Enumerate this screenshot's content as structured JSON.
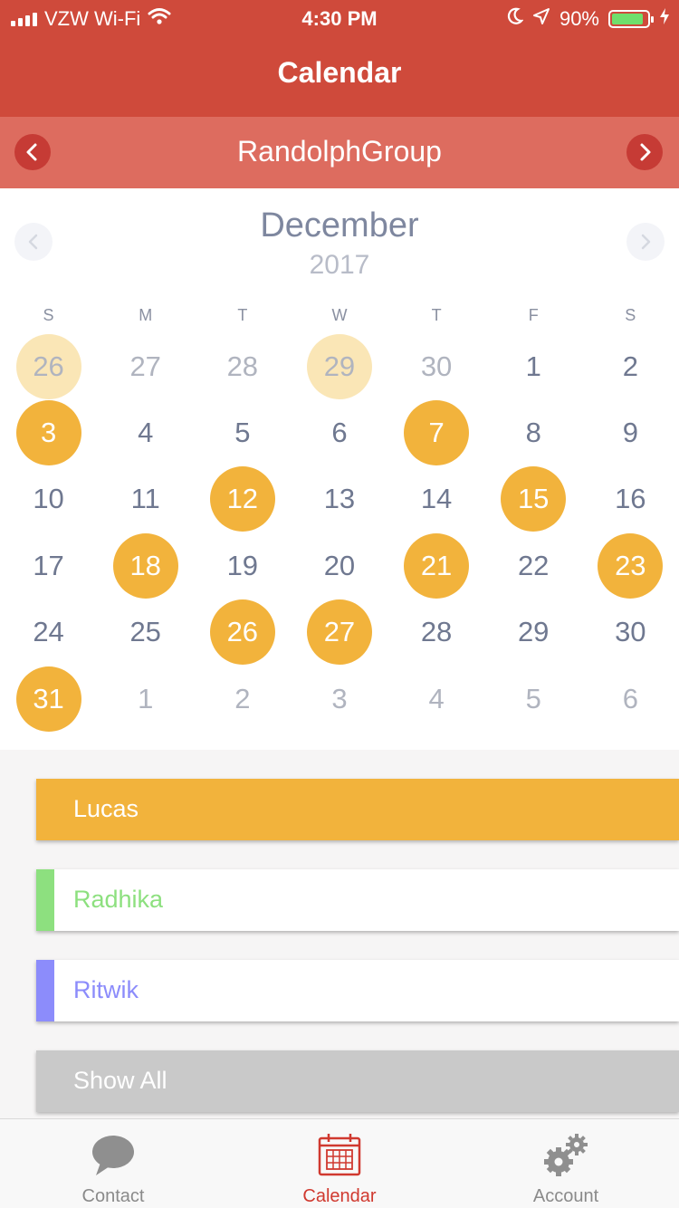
{
  "status_bar": {
    "carrier": "VZW Wi-Fi",
    "time": "4:30 PM",
    "battery": "90%",
    "battery_level": 0.9,
    "icons": [
      "signal-icon",
      "wifi-icon",
      "moon-icon",
      "location-icon",
      "battery-icon",
      "charging-icon"
    ]
  },
  "nav": {
    "title": "Calendar"
  },
  "group_bar": {
    "name": "RandolphGroup",
    "prev_icon": "chevron-left-icon",
    "next_icon": "chevron-right-icon"
  },
  "calendar": {
    "month": "December",
    "year": "2017",
    "weekdays": [
      "S",
      "M",
      "T",
      "W",
      "T",
      "F",
      "S"
    ],
    "days": [
      {
        "n": "26",
        "muted": true,
        "event": true
      },
      {
        "n": "27",
        "muted": true,
        "event": false
      },
      {
        "n": "28",
        "muted": true,
        "event": false
      },
      {
        "n": "29",
        "muted": true,
        "event": true
      },
      {
        "n": "30",
        "muted": true,
        "event": false
      },
      {
        "n": "1",
        "muted": false,
        "event": false
      },
      {
        "n": "2",
        "muted": false,
        "event": false
      },
      {
        "n": "3",
        "muted": false,
        "event": true
      },
      {
        "n": "4",
        "muted": false,
        "event": false
      },
      {
        "n": "5",
        "muted": false,
        "event": false
      },
      {
        "n": "6",
        "muted": false,
        "event": false
      },
      {
        "n": "7",
        "muted": false,
        "event": true
      },
      {
        "n": "8",
        "muted": false,
        "event": false
      },
      {
        "n": "9",
        "muted": false,
        "event": false
      },
      {
        "n": "10",
        "muted": false,
        "event": false
      },
      {
        "n": "11",
        "muted": false,
        "event": false
      },
      {
        "n": "12",
        "muted": false,
        "event": true
      },
      {
        "n": "13",
        "muted": false,
        "event": false
      },
      {
        "n": "14",
        "muted": false,
        "event": false
      },
      {
        "n": "15",
        "muted": false,
        "event": true
      },
      {
        "n": "16",
        "muted": false,
        "event": false
      },
      {
        "n": "17",
        "muted": false,
        "event": false
      },
      {
        "n": "18",
        "muted": false,
        "event": true
      },
      {
        "n": "19",
        "muted": false,
        "event": false
      },
      {
        "n": "20",
        "muted": false,
        "event": false
      },
      {
        "n": "21",
        "muted": false,
        "event": true
      },
      {
        "n": "22",
        "muted": false,
        "event": false
      },
      {
        "n": "23",
        "muted": false,
        "event": true
      },
      {
        "n": "24",
        "muted": false,
        "event": false
      },
      {
        "n": "25",
        "muted": false,
        "event": false
      },
      {
        "n": "26",
        "muted": false,
        "event": true
      },
      {
        "n": "27",
        "muted": false,
        "event": true
      },
      {
        "n": "28",
        "muted": false,
        "event": false
      },
      {
        "n": "29",
        "muted": false,
        "event": false
      },
      {
        "n": "30",
        "muted": false,
        "event": false
      },
      {
        "n": "31",
        "muted": false,
        "event": true
      },
      {
        "n": "1",
        "muted": true,
        "event": false
      },
      {
        "n": "2",
        "muted": true,
        "event": false
      },
      {
        "n": "3",
        "muted": true,
        "event": false
      },
      {
        "n": "4",
        "muted": true,
        "event": false
      },
      {
        "n": "5",
        "muted": true,
        "event": false
      },
      {
        "n": "6",
        "muted": true,
        "event": false
      }
    ]
  },
  "members": [
    {
      "name": "Lucas",
      "color": "#f2b33c",
      "selected": true
    },
    {
      "name": "Radhika",
      "color": "#8de07f",
      "selected": false
    },
    {
      "name": "Ritwik",
      "color": "#8c8cfb",
      "selected": false
    }
  ],
  "show_all": {
    "label": "Show All"
  },
  "tabs": [
    {
      "label": "Contact",
      "icon": "chat-bubble-icon",
      "active": false
    },
    {
      "label": "Calendar",
      "icon": "calendar-icon",
      "active": true
    },
    {
      "label": "Account",
      "icon": "gears-icon",
      "active": false
    }
  ],
  "colors": {
    "primary_red": "#cf4a3b",
    "group_bar": "#dd6c5f",
    "event_orange": "#f2b33c",
    "event_muted": "#fae6b6",
    "tab_active": "#d0392f"
  }
}
